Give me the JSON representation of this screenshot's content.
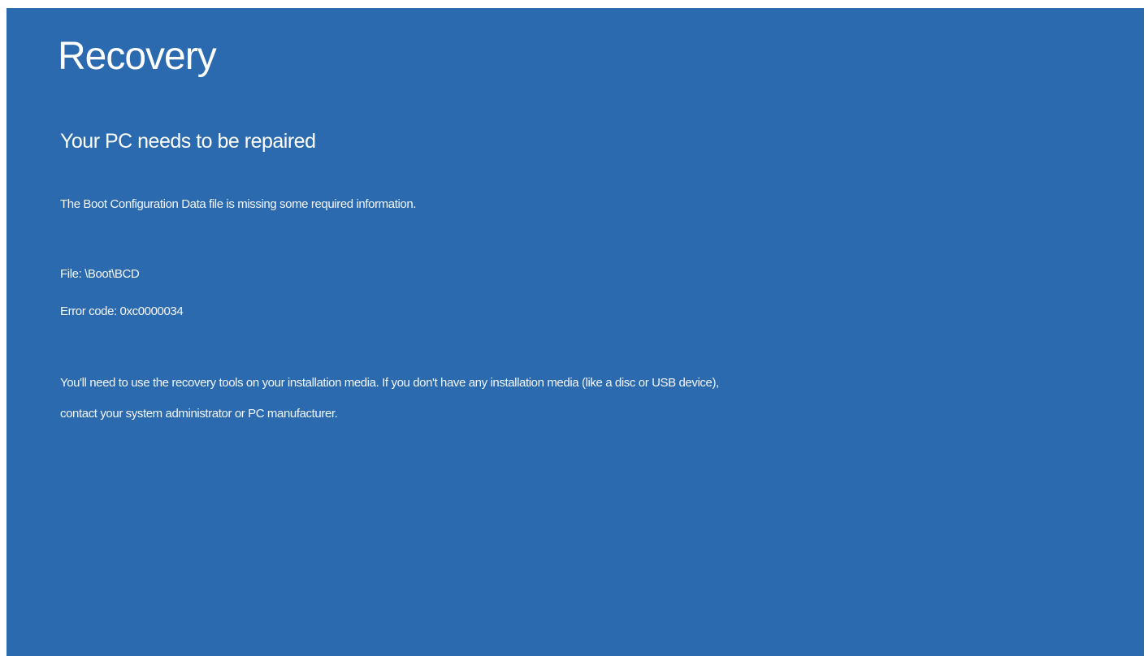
{
  "screen": {
    "title": "Recovery",
    "subtitle": "Your PC needs to be repaired",
    "description": "The Boot Configuration Data file is missing some required information.",
    "file_line": "File: \\Boot\\BCD",
    "error_code_line": "Error code: 0xc0000034",
    "help_line_1": "You'll need to use the recovery tools on your installation media. If you don't have any installation media (like a disc or USB device),",
    "help_line_2": "contact your system administrator or PC manufacturer."
  },
  "colors": {
    "background": "#2b6aae",
    "text": "#ffffff"
  }
}
